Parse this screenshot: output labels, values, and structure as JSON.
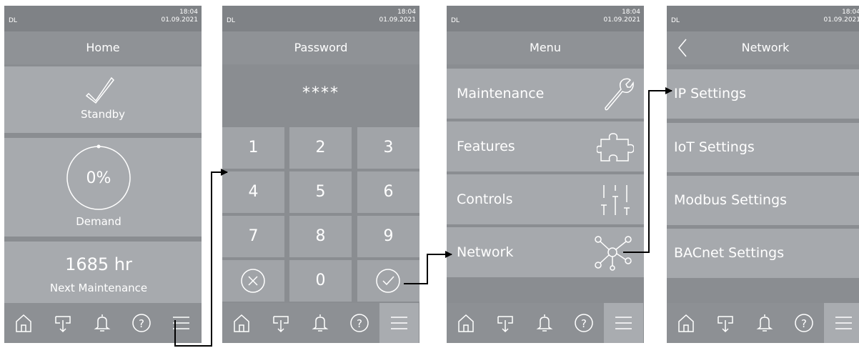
{
  "status": {
    "left_label": "DL",
    "time": "18:04",
    "date": "01.09.2021"
  },
  "home": {
    "title": "Home",
    "state_label": "Standby",
    "demand_value": "0%",
    "demand_label": "Demand",
    "maintenance_value": "1685 hr",
    "maintenance_label": "Next Maintenance"
  },
  "password": {
    "title": "Password",
    "masked_value": "****",
    "keys": [
      "1",
      "2",
      "3",
      "4",
      "5",
      "6",
      "7",
      "8",
      "9",
      "0"
    ]
  },
  "menu": {
    "title": "Menu",
    "items": [
      {
        "label": "Maintenance",
        "icon": "wrench-icon"
      },
      {
        "label": "Features",
        "icon": "puzzle-icon"
      },
      {
        "label": "Controls",
        "icon": "sliders-icon"
      },
      {
        "label": "Network",
        "icon": "network-icon"
      }
    ]
  },
  "network": {
    "title": "Network",
    "items": [
      {
        "label": "IP Settings"
      },
      {
        "label": "IoT Settings"
      },
      {
        "label": "Modbus Settings"
      },
      {
        "label": "BACnet Settings"
      }
    ]
  },
  "navbar": {
    "icons": [
      "home-icon",
      "humidifier-icon",
      "bell-icon",
      "help-icon",
      "menu-icon"
    ]
  },
  "colors": {
    "screen_bg": "#8a8d91",
    "panel_bg": "#a7aaae",
    "arrow": "#000000"
  }
}
